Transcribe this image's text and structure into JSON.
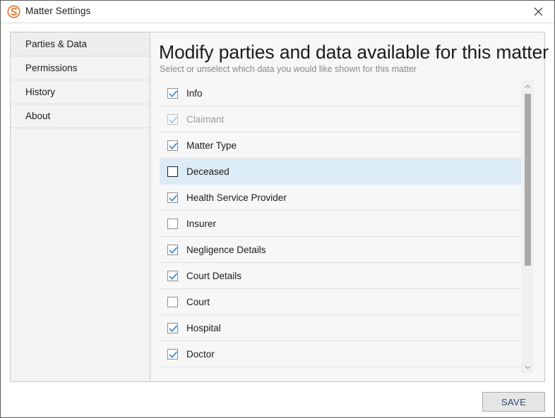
{
  "window": {
    "title": "Matter Settings",
    "app_icon": "spiral-logo-icon",
    "close_icon": "close-icon",
    "brand_color": "#e8702a"
  },
  "sidebar": {
    "items": [
      {
        "label": "Parties & Data",
        "active": true
      },
      {
        "label": "Permissions",
        "active": false
      },
      {
        "label": "History",
        "active": false
      },
      {
        "label": "About",
        "active": false
      }
    ]
  },
  "main": {
    "heading": "Modify parties and data available for this matter",
    "subheading": "Select or unselect which data you would like shown for this matter",
    "items": [
      {
        "label": "Info",
        "checked": true,
        "disabled": false,
        "hovered": false
      },
      {
        "label": "Claimant",
        "checked": true,
        "disabled": true,
        "hovered": false
      },
      {
        "label": "Matter Type",
        "checked": true,
        "disabled": false,
        "hovered": false
      },
      {
        "label": "Deceased",
        "checked": false,
        "disabled": false,
        "hovered": true
      },
      {
        "label": "Health Service Provider",
        "checked": true,
        "disabled": false,
        "hovered": false
      },
      {
        "label": "Insurer",
        "checked": false,
        "disabled": false,
        "hovered": false
      },
      {
        "label": "Negligence Details",
        "checked": true,
        "disabled": false,
        "hovered": false
      },
      {
        "label": "Court Details",
        "checked": true,
        "disabled": false,
        "hovered": false
      },
      {
        "label": "Court",
        "checked": false,
        "disabled": false,
        "hovered": false
      },
      {
        "label": "Hospital",
        "checked": true,
        "disabled": false,
        "hovered": false
      },
      {
        "label": "Doctor",
        "checked": true,
        "disabled": false,
        "hovered": false
      }
    ],
    "scrollbar": {
      "up_icon": "chevron-up-icon",
      "down_icon": "chevron-down-icon",
      "thumb": "scrollbar-thumb"
    }
  },
  "footer": {
    "save_label": "SAVE"
  }
}
